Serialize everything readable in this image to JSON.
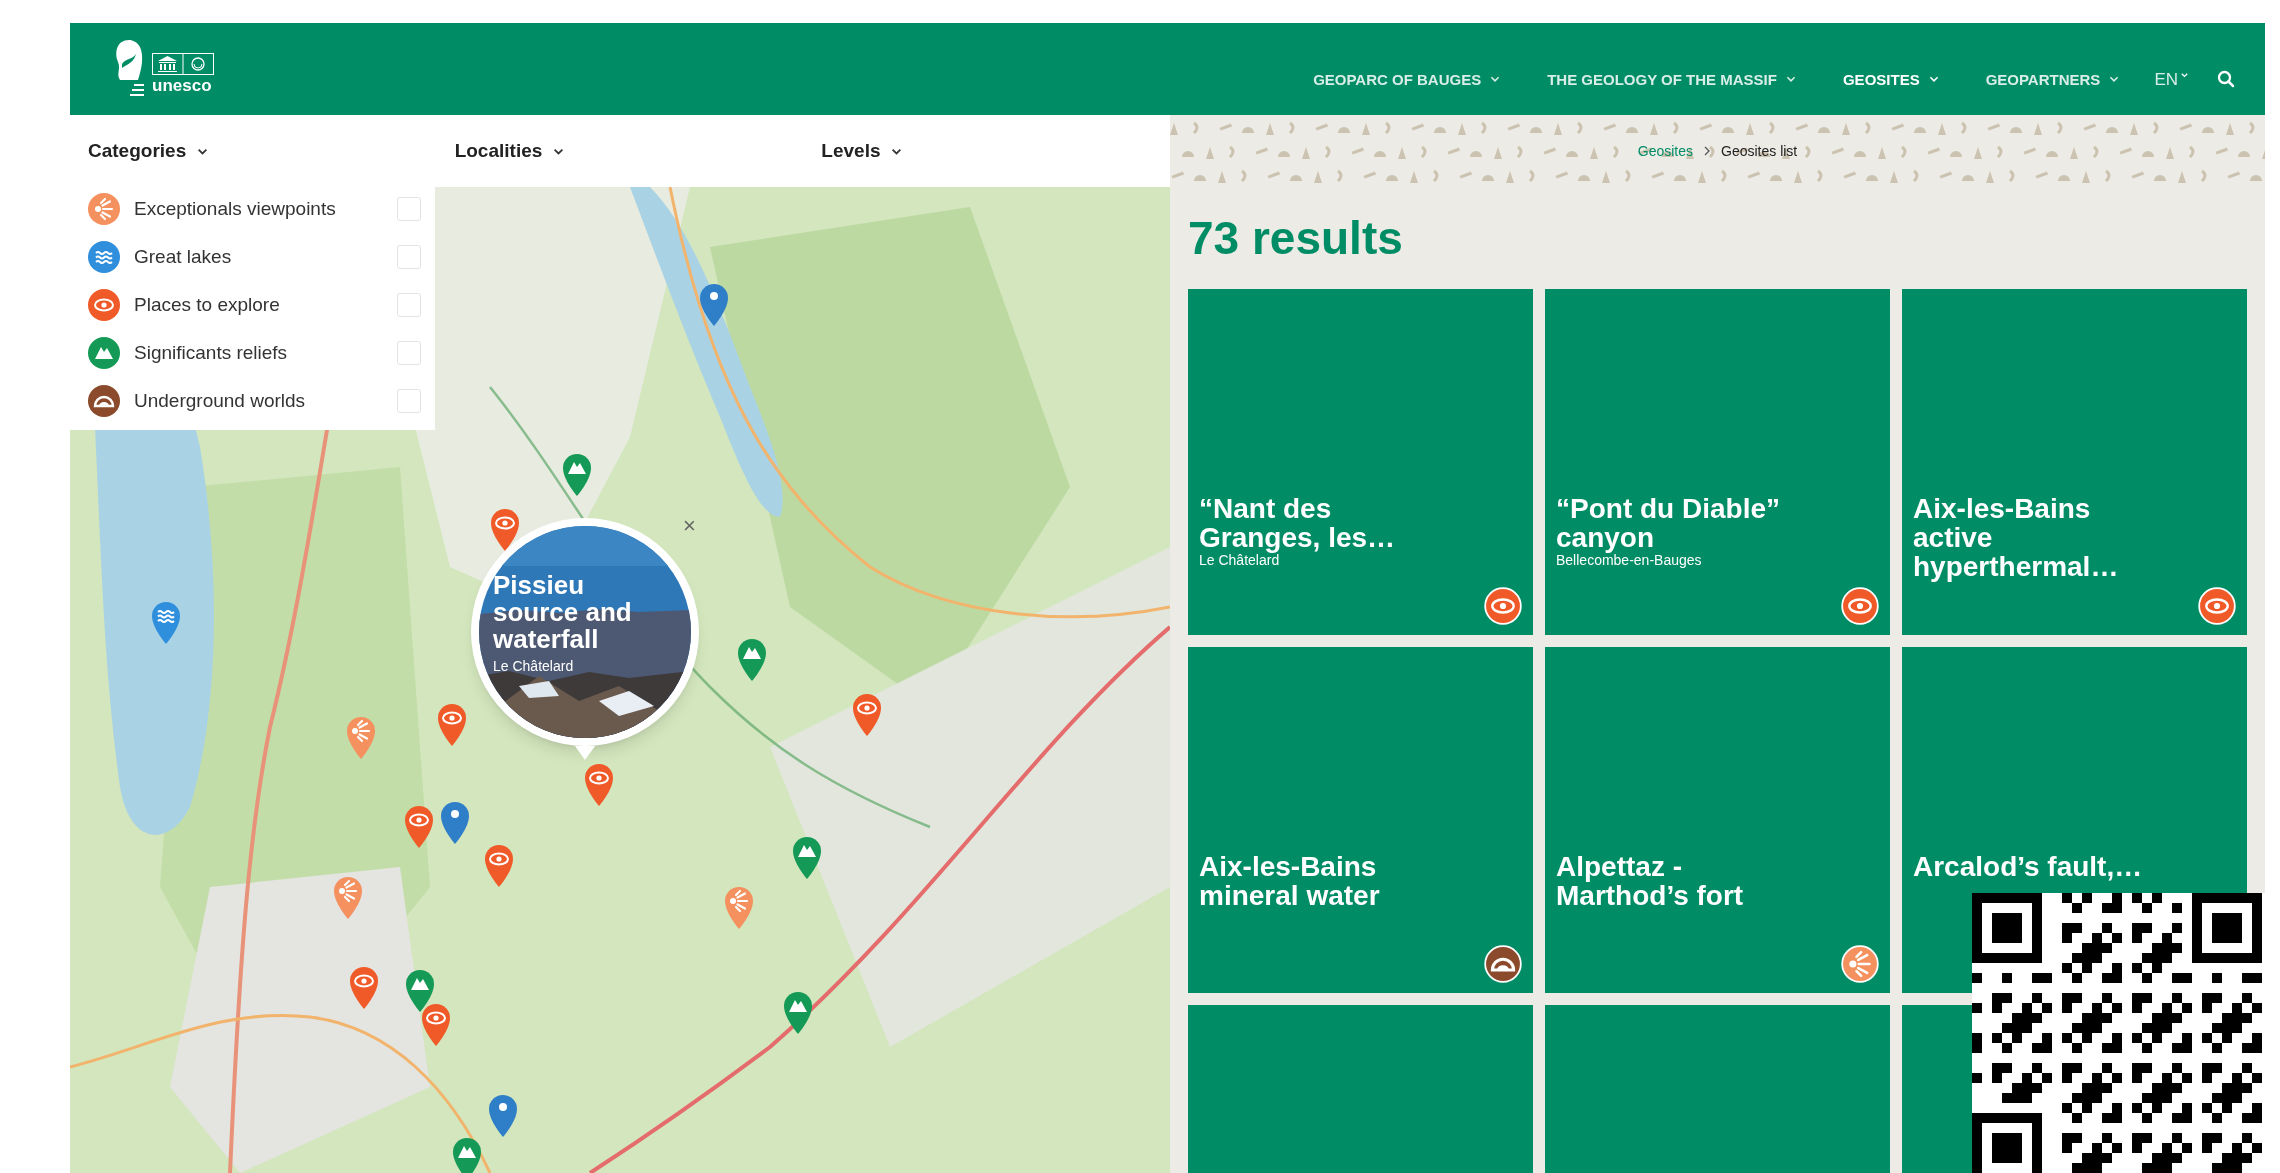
{
  "header": {
    "logo_text": "unesco",
    "nav": [
      {
        "label": "GEOPARC OF BAUGES",
        "selected": false
      },
      {
        "label": "THE GEOLOGY OF THE MASSIF",
        "selected": false
      },
      {
        "label": "GEOSITES",
        "selected": true
      },
      {
        "label": "GEOPARTNERS",
        "selected": false
      }
    ],
    "language": "EN"
  },
  "filters": [
    {
      "label": "Categories",
      "options": [
        {
          "label": "Exceptionals viewpoints",
          "kind": "viewpoint",
          "checked": false
        },
        {
          "label": "Great lakes",
          "kind": "lake",
          "checked": false
        },
        {
          "label": "Places to explore",
          "kind": "explore",
          "checked": false
        },
        {
          "label": "Significants reliefs",
          "kind": "relief",
          "checked": false
        },
        {
          "label": "Underground worlds",
          "kind": "underground",
          "checked": false
        }
      ]
    },
    {
      "label": "Localities"
    },
    {
      "label": "Levels"
    }
  ],
  "map": {
    "popup": {
      "title": "Pissieu source and waterfall",
      "place": "Le Châtelard",
      "close": "×"
    }
  },
  "breadcrumb": [
    {
      "label": "Geosites",
      "kind": "link"
    },
    {
      "label": "Geosites list",
      "kind": "current"
    }
  ],
  "results_count": "73 results",
  "cards": [
    {
      "kind": "geosite",
      "title": "“Nant des Granges, les…",
      "place": "Le Châtelard",
      "icon": {
        "kind": "explore"
      }
    },
    {
      "kind": "geosite",
      "title": "“Pont du Diable” canyon",
      "place": "Bellecombe-en-Bauges",
      "icon": {
        "kind": "explore"
      }
    },
    {
      "kind": "geosite",
      "title": "Aix-les-Bains active hyperthermal…",
      "icon": {
        "kind": "explore"
      }
    },
    {
      "kind": "geosite",
      "title": "Aix-les-Bains mineral water",
      "icon": {
        "kind": "underground"
      }
    },
    {
      "kind": "geosite",
      "title": "Alpettaz - Marthod’s fort",
      "icon": {
        "kind": "viewpoint"
      }
    },
    {
      "kind": "geosite",
      "title": "Arcalod’s fault,…"
    },
    {
      "kind": "placeholder"
    },
    {
      "kind": "placeholder"
    },
    {
      "kind": "placeholder"
    }
  ]
}
